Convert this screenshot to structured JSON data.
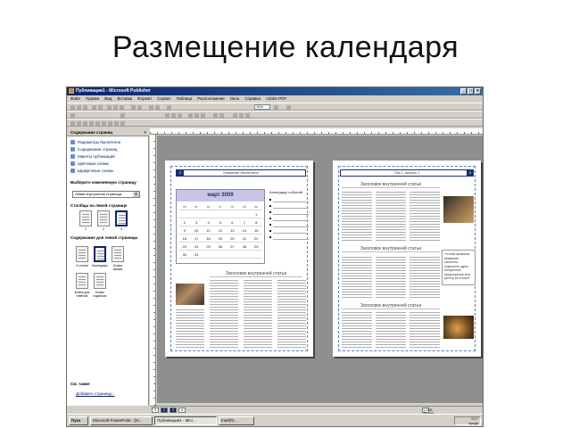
{
  "slide": {
    "title": "Размещение календаря"
  },
  "window": {
    "title": "Публикация1 - Microsoft Publisher",
    "menu": [
      "Файл",
      "Правка",
      "Вид",
      "Вставка",
      "Формат",
      "Сервис",
      "Таблица",
      "Расположение",
      "Окно",
      "Справка",
      "Adobe PDF"
    ],
    "zoom": "76%"
  },
  "task_pane": {
    "title": "Содержание страниц",
    "links": [
      "Параметры бюллетеня",
      "Содержание страниц",
      "Макеты публикаций",
      "Цветовые схемы",
      "Шрифтовые схемы"
    ],
    "choose_label": "Выберите изменяемую страницу",
    "select_value": "Левая внутренняя страница",
    "columns_label": "Столбцы на левой странице",
    "columns_options": [
      "1",
      "2",
      "3"
    ],
    "content_label": "Содержание для левой страницы",
    "content_options": [
      "3 статьи",
      "Календарь",
      "Бланк заказа",
      "Бланк для ответов",
      "Бланк подписки"
    ],
    "see_also": "См. также",
    "add_page_link": "Добавить страницу..."
  },
  "document": {
    "left_page": {
      "page_number": "2",
      "header": "Название бюллетеня",
      "calendar": {
        "title": "март 2009",
        "days_of_week": [
          "пн",
          "вт",
          "ср",
          "чт",
          "пт",
          "сб",
          "вс"
        ],
        "days": [
          "",
          "",
          "",
          "",
          "",
          "",
          "1",
          "2",
          "3",
          "4",
          "5",
          "6",
          "7",
          "8",
          "9",
          "10",
          "11",
          "12",
          "13",
          "14",
          "15",
          "16",
          "17",
          "18",
          "19",
          "20",
          "21",
          "22",
          "23",
          "24",
          "25",
          "26",
          "27",
          "28",
          "29",
          "30",
          "31",
          "",
          "",
          "",
          "",
          ""
        ]
      },
      "events_title": "Календарь событий",
      "article_title": "Заголовок внутренней статьи"
    },
    "right_page": {
      "page_number": "3",
      "header": "Том 1, выпуск 1",
      "article_title_1": "Заголовок внутренней статьи",
      "article_title_2": "Заголовок внутренней статьи",
      "article_title_3": "Заголовок внутренней статьи",
      "pull_quote": "«Чтобы привлечь внимание читателя, поместите здесь интересное предложение или цитату из статьи»"
    }
  },
  "page_tabs": [
    "1",
    "2",
    "3",
    "4"
  ],
  "status": {
    "position": "1,240; 20,400 см."
  },
  "taskbar": {
    "start": "Пуск",
    "buttons": [
      "Microsoft PowerPoint - [Ki...",
      "Публикация1 - Micr...",
      "Intel(R) ..."
    ],
    "time": "9:17",
    "day": "среда"
  }
}
